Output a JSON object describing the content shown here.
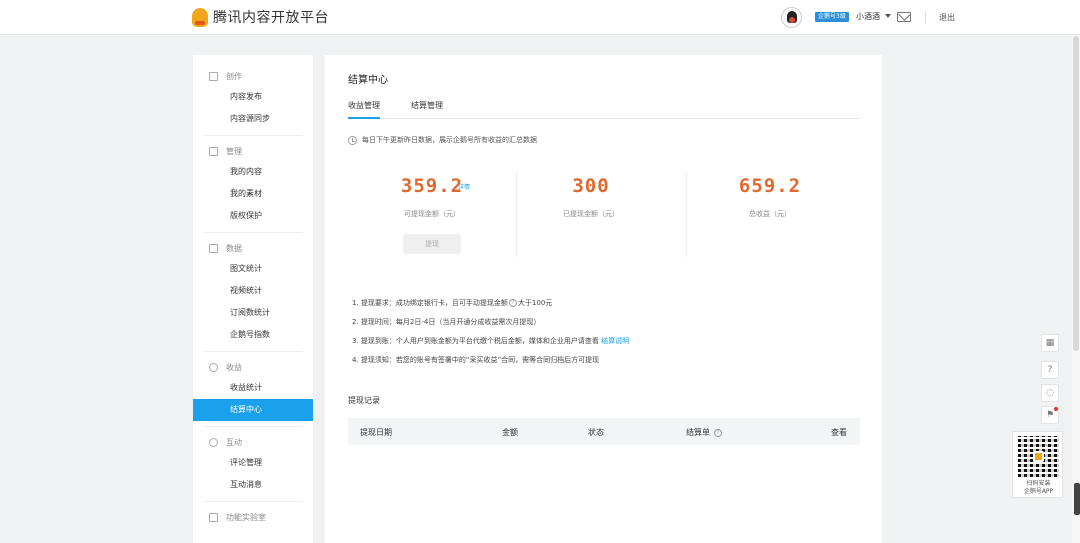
{
  "header": {
    "logo_text": "腾讯内容开放平台",
    "level_badge": "企鹅号3级",
    "username": "小酒酒",
    "logout": "退出"
  },
  "sidebar": {
    "groups": [
      {
        "title": "创作",
        "icon": "edit-icon",
        "items": [
          "内容发布",
          "内容源同步"
        ]
      },
      {
        "title": "管理",
        "icon": "manage-icon",
        "items": [
          "我的内容",
          "我的素材",
          "版权保护"
        ]
      },
      {
        "title": "数据",
        "icon": "chart-icon",
        "items": [
          "图文统计",
          "视频统计",
          "订阅数统计",
          "企鹅号指数"
        ]
      },
      {
        "title": "收益",
        "icon": "coin-icon",
        "items": [
          "收益统计",
          "结算中心"
        ]
      },
      {
        "title": "互动",
        "icon": "chat-icon",
        "items": [
          "评论管理",
          "互动消息"
        ]
      },
      {
        "title": "功能实验室",
        "icon": "lab-icon",
        "items": []
      }
    ],
    "active_item": "结算中心"
  },
  "main": {
    "title": "结算中心",
    "tabs": [
      "收益管理",
      "结算管理"
    ],
    "active_tab": "收益管理",
    "notice": "每日下午更新昨日数据，展示企鹅号所有收益的汇总数据",
    "stats": [
      {
        "value": "359.2",
        "label": "可提现金额（元）"
      },
      {
        "value": "300",
        "label": "已提现金额（元）"
      },
      {
        "value": "659.2",
        "label": "总收益（元）"
      }
    ],
    "detail_link": "详情",
    "withdraw_button": "提现",
    "rules": [
      {
        "a": "1. 提现要求：成功绑定银行卡，且可手动提现金额",
        "b": "大于100元"
      },
      {
        "a": "2. 提现时间：每月2日-4日（当月开通分成收益需次月提现）"
      },
      {
        "a": "3. 提现到账：个人用户到账金额为平台代缴个税后金额，媒体和企业用户请查看",
        "link": "结算说明"
      },
      {
        "a": "4. 提现须知：若您的账号有签署中的“采买收益”合同，需等合同归档后方可提现"
      }
    ],
    "records_title": "提现记录",
    "table_headers": [
      "提现日期",
      "金额",
      "状态",
      "结算单",
      "查看"
    ]
  },
  "float_tools": {
    "qr_caption_1": "扫码安装",
    "qr_caption_2": "企鹅号APP"
  },
  "colors": {
    "accent": "#1ba0ec",
    "amount": "#e0692d",
    "logo": "#f2a61c"
  }
}
